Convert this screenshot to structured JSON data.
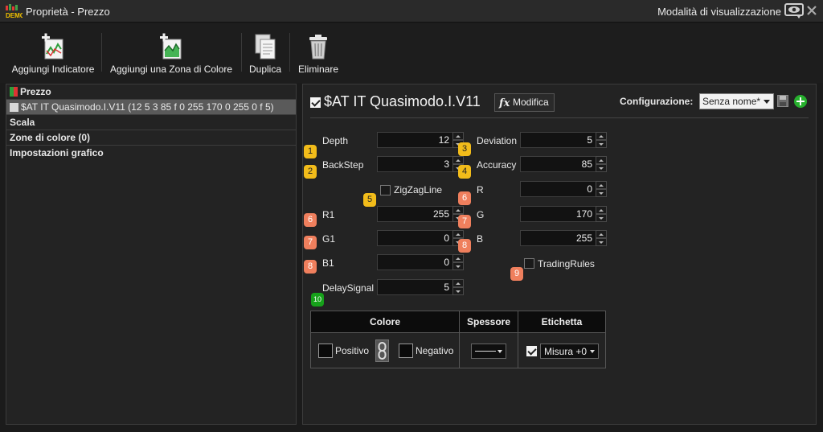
{
  "window": {
    "title": "Proprietà - Prezzo",
    "view_mode": "Modalità di visualizzazione",
    "logo_text": "DEMO"
  },
  "toolbar": {
    "add_indicator": "Aggiungi Indicatore",
    "add_color_zone": "Aggiungi una Zona di Colore",
    "duplicate": "Duplica",
    "delete": "Eliminare"
  },
  "tree": {
    "price": "Prezzo",
    "indicator": "$AT IT Quasimodo.I.V11 (12 5 3 85 f 0 255 170 0 255 0 f 5)",
    "scale": "Scala",
    "color_zones": "Zone di colore (0)",
    "chart_settings": "Impostazioni grafico"
  },
  "indicator": {
    "title": "$AT IT Quasimodo.I.V11",
    "modify_label": "Modifica",
    "fx_glyph": "fx",
    "config_label": "Configurazione:",
    "config_value": "Senza nome*"
  },
  "params": {
    "depth": {
      "label": "Depth",
      "value": "12"
    },
    "backstep": {
      "label": "BackStep",
      "value": "3"
    },
    "deviation": {
      "label": "Deviation",
      "value": "5"
    },
    "accuracy": {
      "label": "Accuracy",
      "value": "85"
    },
    "zigzag": {
      "label": "ZigZagLine"
    },
    "r": {
      "label": "R",
      "value": "0"
    },
    "r1": {
      "label": "R1",
      "value": "255"
    },
    "g": {
      "label": "G",
      "value": "170"
    },
    "g1": {
      "label": "G1",
      "value": "0"
    },
    "b": {
      "label": "B",
      "value": "255"
    },
    "b1": {
      "label": "B1",
      "value": "0"
    },
    "trading_rules": {
      "label": "TradingRules"
    },
    "delay_signal": {
      "label": "DelaySignal",
      "value": "5"
    }
  },
  "badges": {
    "n1": "1",
    "n2": "2",
    "n3": "3",
    "n4": "4",
    "n5": "5",
    "n6": "6",
    "n7": "7",
    "n8": "8",
    "n9": "9",
    "n10": "10"
  },
  "style_table": {
    "col_color": "Colore",
    "col_thickness": "Spessore",
    "col_label": "Etichetta",
    "positive": "Positivo",
    "negative": "Negativo",
    "label_value": "Misura +0"
  },
  "colors": {
    "badge_yellow": "#f2bc1a",
    "badge_orange": "#ef7f5d",
    "badge_green": "#16a11a",
    "selected_row": "#5a5a5a"
  }
}
